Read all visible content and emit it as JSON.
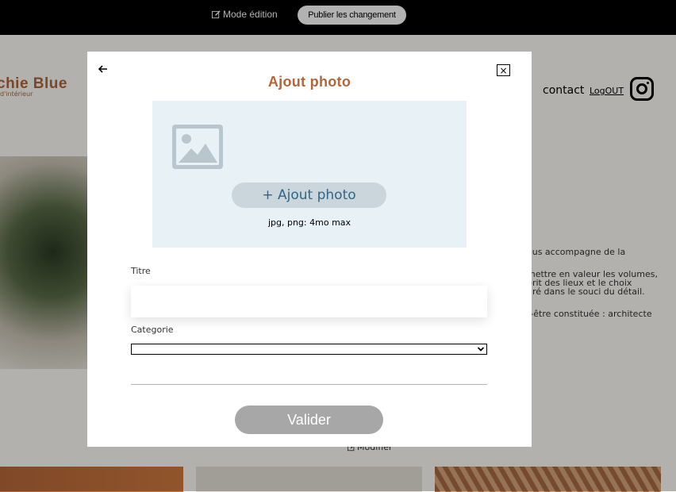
{
  "topbar": {
    "mode_label": "Mode édition",
    "publish_label": "Publier les changement"
  },
  "header": {
    "logo_name": "chie Blue",
    "logo_sub": "d'intérieur",
    "nav_contact": "contact",
    "nav_logout": "LogOUT",
    "social_icon": "instagram-icon"
  },
  "about": {
    "lines": [
      "ous accompagne de la",
      "mettre en valeur les volumes,",
      "prit des lieux et le choix",
      "uré dans le souci du détail.",
      "t-être constituée : architecte"
    ]
  },
  "gallery": {
    "edit_label": "Modifier"
  },
  "modal": {
    "back_icon": "arrow-left-icon",
    "close_label": "×",
    "title": "Ajout photo",
    "upload": {
      "image_icon": "image-placeholder-icon",
      "button_label": "+ Ajout photo",
      "hint": "jpg, png: 4mo max"
    },
    "fields": {
      "titre_label": "Titre",
      "titre_value": "",
      "categorie_label": "Categorie",
      "categorie_value": ""
    },
    "submit_label": "Valider"
  },
  "colors": {
    "accent": "#b1663c",
    "upload_bg": "#e8f1f6",
    "upload_button_bg": "#cbd6dc",
    "upload_button_text": "#306685",
    "submit_disabled": "#a7a7a7"
  }
}
